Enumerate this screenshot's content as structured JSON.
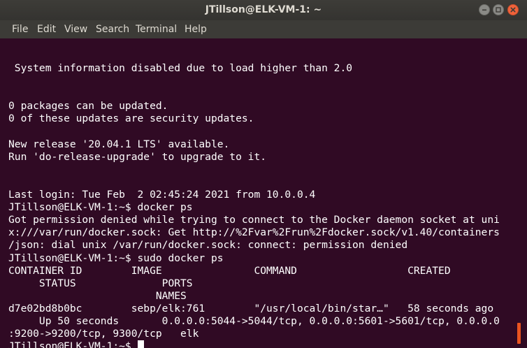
{
  "window": {
    "title": "JTillson@ELK-VM-1: ~",
    "accent": "#e95420",
    "terminal_bg": "#300a24"
  },
  "menu": {
    "items": [
      "File",
      "Edit",
      "View",
      "Search",
      "Terminal",
      "Help"
    ]
  },
  "terminal": {
    "lines": [
      "",
      " System information disabled due to load higher than 2.0",
      "",
      "",
      "0 packages can be updated.",
      "0 of these updates are security updates.",
      "",
      "New release '20.04.1 LTS' available.",
      "Run 'do-release-upgrade' to upgrade to it.",
      "",
      "",
      "Last login: Tue Feb  2 02:45:24 2021 from 10.0.0.4",
      "JTillson@ELK-VM-1:~$ docker ps",
      "Got permission denied while trying to connect to the Docker daemon socket at uni",
      "x:///var/run/docker.sock: Get http://%2Fvar%2Frun%2Fdocker.sock/v1.40/containers",
      "/json: dial unix /var/run/docker.sock: connect: permission denied",
      "JTillson@ELK-VM-1:~$ sudo docker ps",
      "CONTAINER ID        IMAGE               COMMAND                  CREATED",
      "     STATUS              PORTS",
      "                        NAMES",
      "d7e02bd8b0bc        sebp/elk:761        \"/usr/local/bin/star…\"   58 seconds ago",
      "     Up 50 seconds       0.0.0.0:5044->5044/tcp, 0.0.0.0:5601->5601/tcp, 0.0.0.0",
      ":9200->9200/tcp, 9300/tcp   elk"
    ],
    "prompt": "JTillson@ELK-VM-1:~$ "
  }
}
